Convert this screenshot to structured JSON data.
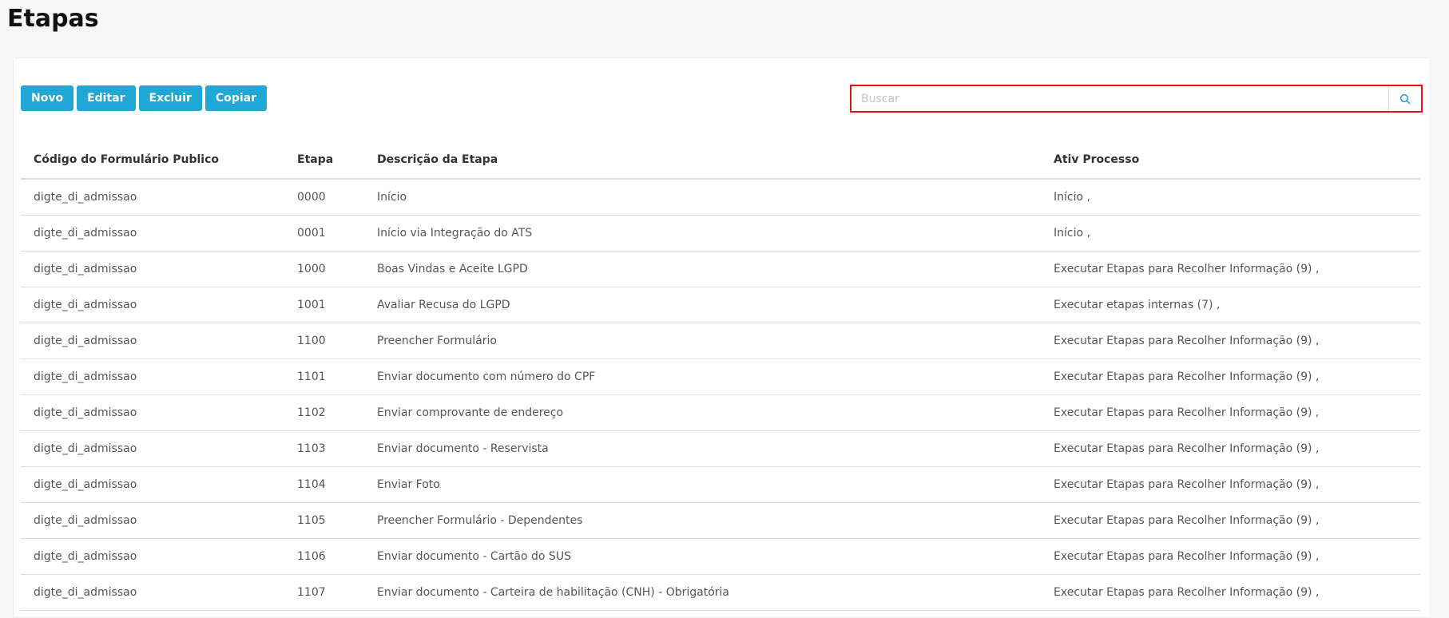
{
  "page": {
    "title": "Etapas"
  },
  "toolbar": {
    "new_label": "Novo",
    "edit_label": "Editar",
    "delete_label": "Excluir",
    "copy_label": "Copiar"
  },
  "search": {
    "placeholder": "Buscar",
    "value": "",
    "icon": "search-icon"
  },
  "colors": {
    "accent": "#1fa7d6",
    "highlight_border": "#e0121b"
  },
  "table": {
    "headers": [
      "Código do Formulário Publico",
      "Etapa",
      "Descrição da Etapa",
      "Ativ Processo"
    ],
    "rows": [
      [
        "digte_di_admissao",
        "0000",
        "Início",
        "Início ,"
      ],
      [
        "digte_di_admissao",
        "0001",
        "Início via Integração do ATS",
        "Início ,"
      ],
      [
        "digte_di_admissao",
        "1000",
        "Boas Vindas e Aceite LGPD",
        "Executar Etapas para Recolher Informação (9) ,"
      ],
      [
        "digte_di_admissao",
        "1001",
        "Avaliar Recusa do LGPD",
        "Executar etapas internas (7) ,"
      ],
      [
        "digte_di_admissao",
        "1100",
        "Preencher Formulário",
        "Executar Etapas para Recolher Informação (9) ,"
      ],
      [
        "digte_di_admissao",
        "1101",
        "Enviar documento com número do CPF",
        "Executar Etapas para Recolher Informação (9) ,"
      ],
      [
        "digte_di_admissao",
        "1102",
        "Enviar comprovante de endereço",
        "Executar Etapas para Recolher Informação (9) ,"
      ],
      [
        "digte_di_admissao",
        "1103",
        "Enviar documento - Reservista",
        "Executar Etapas para Recolher Informação (9) ,"
      ],
      [
        "digte_di_admissao",
        "1104",
        "Enviar Foto",
        "Executar Etapas para Recolher Informação (9) ,"
      ],
      [
        "digte_di_admissao",
        "1105",
        "Preencher Formulário - Dependentes",
        "Executar Etapas para Recolher Informação (9) ,"
      ],
      [
        "digte_di_admissao",
        "1106",
        "Enviar documento - Cartão do SUS",
        "Executar Etapas para Recolher Informação (9) ,"
      ],
      [
        "digte_di_admissao",
        "1107",
        "Enviar documento - Carteira de habilitação (CNH) - Obrigatória",
        "Executar Etapas para Recolher Informação (9) ,"
      ]
    ]
  }
}
